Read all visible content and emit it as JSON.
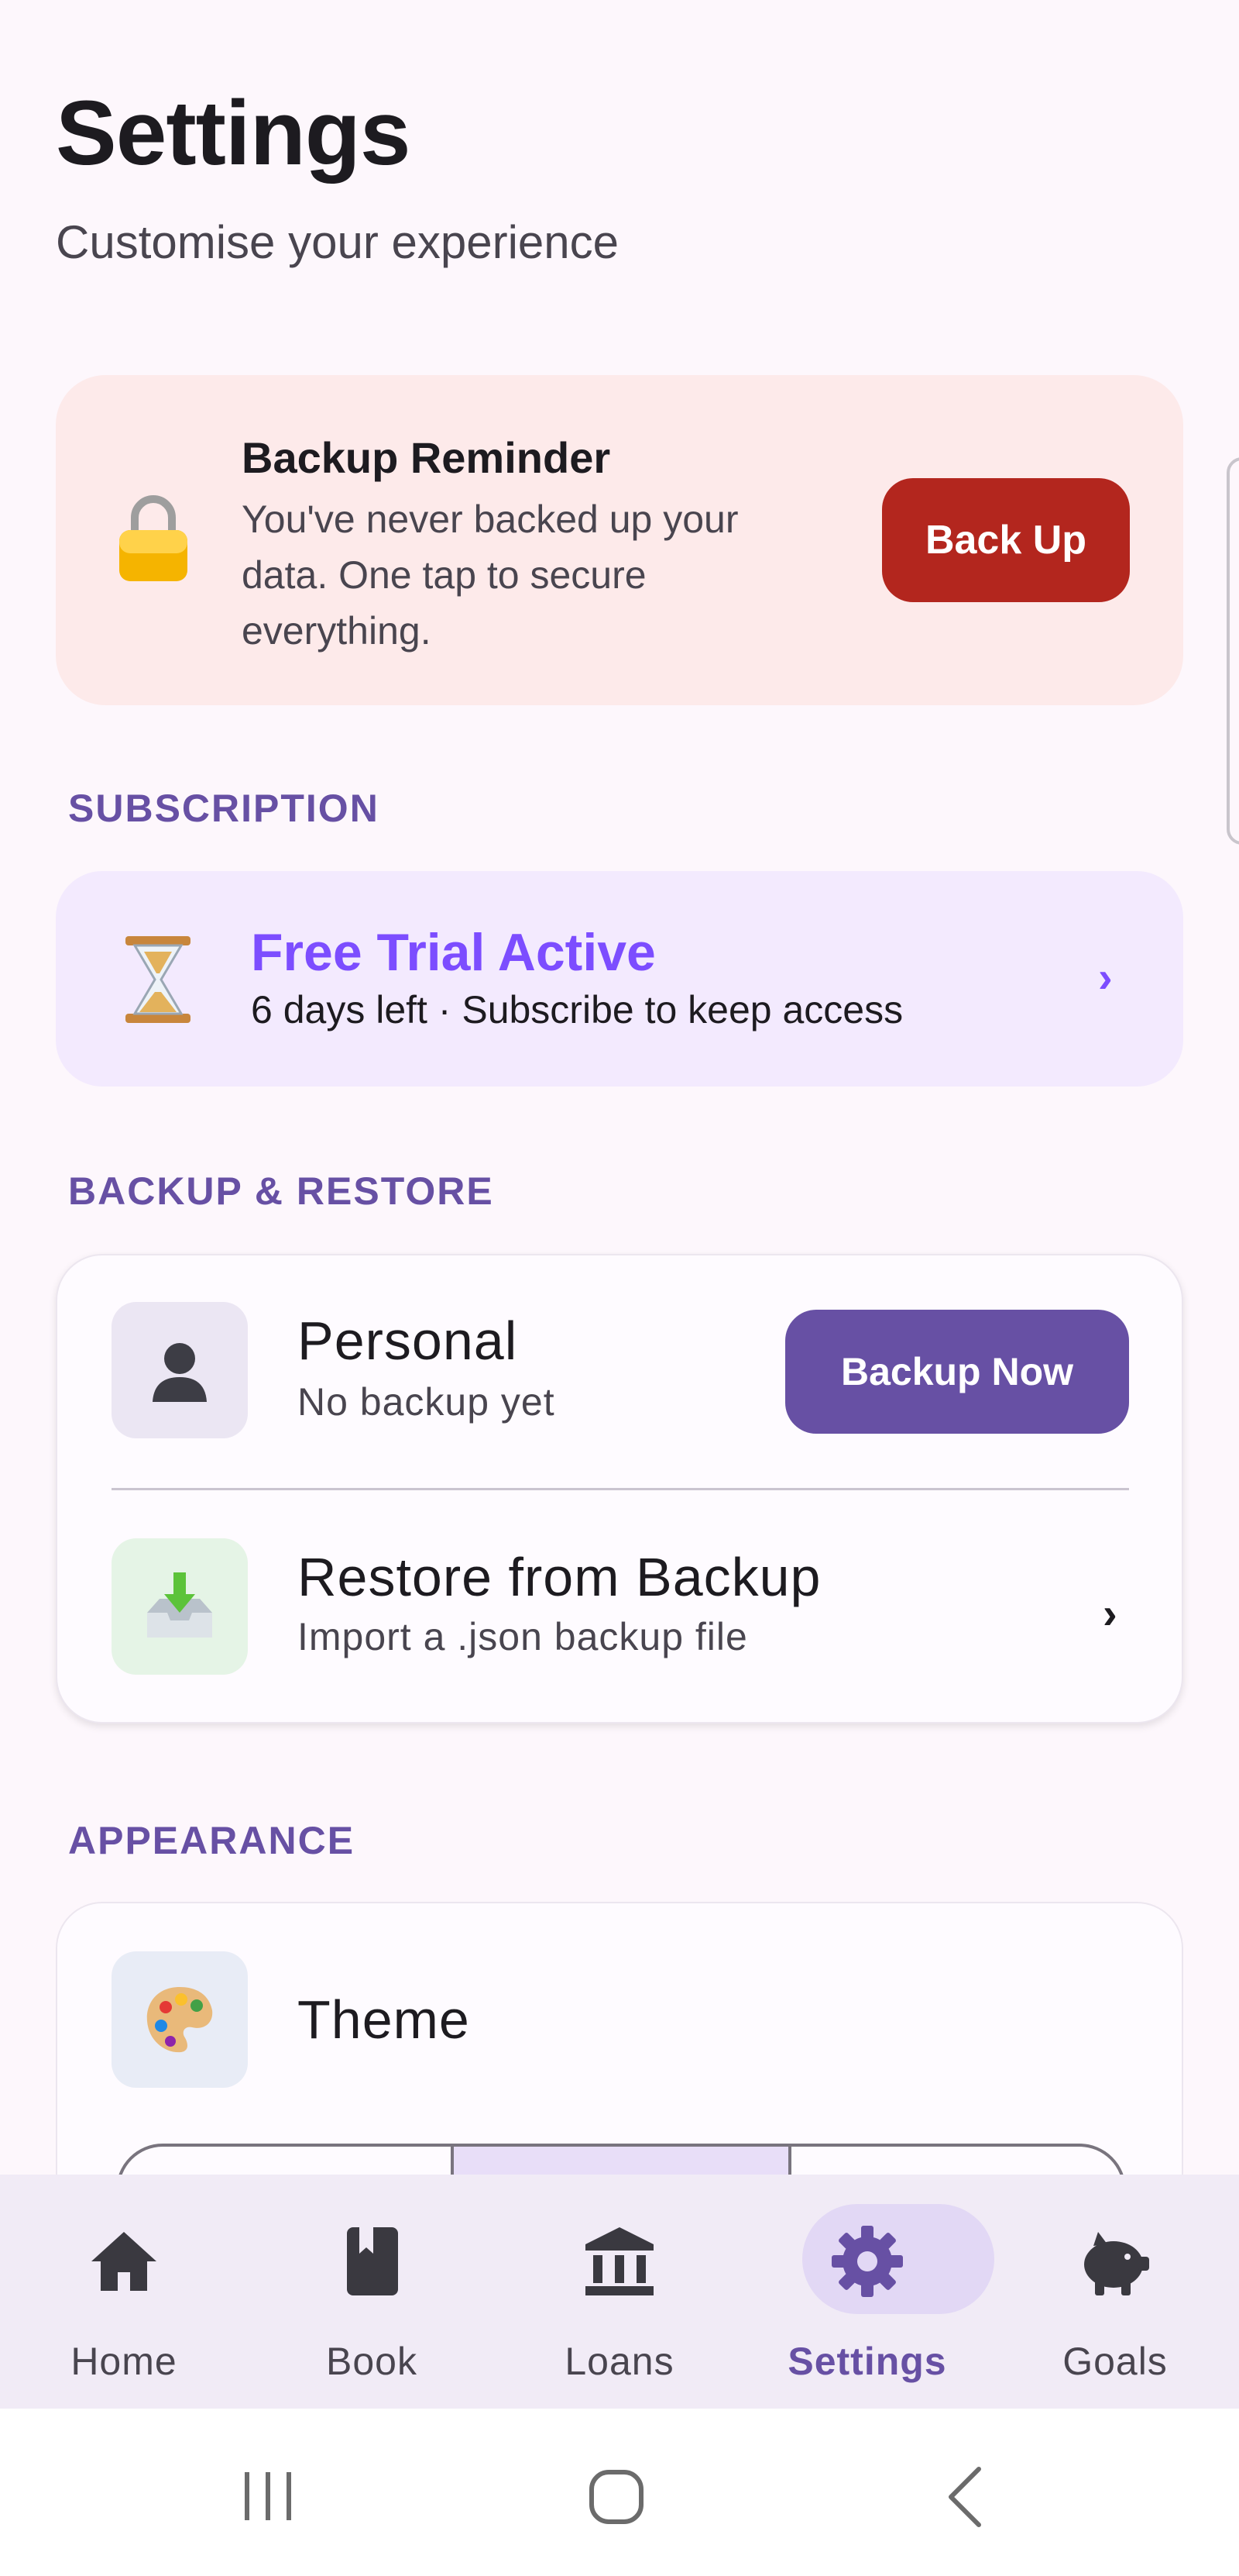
{
  "header": {
    "title": "Settings",
    "subtitle": "Customise your experience"
  },
  "reminder": {
    "title": "Backup Reminder",
    "body": "You've never backed up your data. One tap to secure everything.",
    "button_label": "Back Up",
    "icon": "lock-icon"
  },
  "sections": {
    "subscription": "SUBSCRIPTION",
    "backup_restore": "BACKUP & RESTORE",
    "appearance": "APPEARANCE"
  },
  "subscription": {
    "title": "Free Trial Active",
    "subtitle": "6 days left · Subscribe to keep access",
    "icon": "hourglass-icon"
  },
  "backup": {
    "profile_name": "Personal",
    "profile_status": "No backup yet",
    "backup_button": "Backup Now",
    "restore_title": "Restore from Backup",
    "restore_subtitle": "Import a .json backup file"
  },
  "appearance": {
    "theme_label": "Theme"
  },
  "bottom_nav": {
    "items": [
      {
        "label": "Home",
        "icon": "home-icon"
      },
      {
        "label": "Book",
        "icon": "book-icon"
      },
      {
        "label": "Loans",
        "icon": "bank-icon"
      },
      {
        "label": "Settings",
        "icon": "gear-icon",
        "active": true
      },
      {
        "label": "Goals",
        "icon": "piggy-bank-icon"
      }
    ]
  },
  "colors": {
    "accent": "#6750a4",
    "trial": "#7c4dff",
    "danger": "#b3261e",
    "reminder_bg": "#fdeaea",
    "trial_bg": "#f3eafe"
  }
}
